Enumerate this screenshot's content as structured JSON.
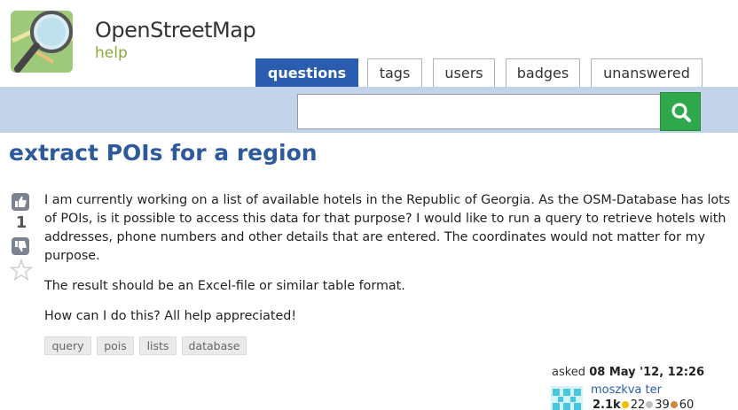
{
  "site": {
    "name": "OpenStreetMap",
    "sub": "help"
  },
  "tabs": [
    {
      "label": "questions",
      "active": true
    },
    {
      "label": "tags",
      "active": false
    },
    {
      "label": "users",
      "active": false
    },
    {
      "label": "badges",
      "active": false
    },
    {
      "label": "unanswered",
      "active": false
    }
  ],
  "search": {
    "value": "",
    "button_icon": "search-icon"
  },
  "question": {
    "title": "extract POIs for a region",
    "votes": "1",
    "paragraphs": [
      "I am currently working on a list of available hotels in the Republic of Georgia. As the OSM-Database has lots of POIs, is it possible to access this data for that purpose? I would like to run a query to retrieve hotels with addresses, phone numbers and other details that are entered. The coordinates would not matter for my purpose.",
      "The result should be an Excel-file or similar table format.",
      "How can I do this? All help appreciated!"
    ],
    "tags": [
      "query",
      "pois",
      "lists",
      "database"
    ]
  },
  "meta": {
    "asked_label": "asked",
    "asked_date": "08 May '12, 12:26",
    "user": "moszkva ter",
    "karma": "2.1k",
    "gold": "22",
    "silver": "39",
    "bronze": "60"
  },
  "colors": {
    "accent": "#2a5db0",
    "title": "#2d5a9c",
    "search_band": "#c3d3ea",
    "search_button": "#2ea84a",
    "gold": "#f0c000",
    "silver": "#c0c0c0",
    "bronze": "#cc8a3c"
  }
}
